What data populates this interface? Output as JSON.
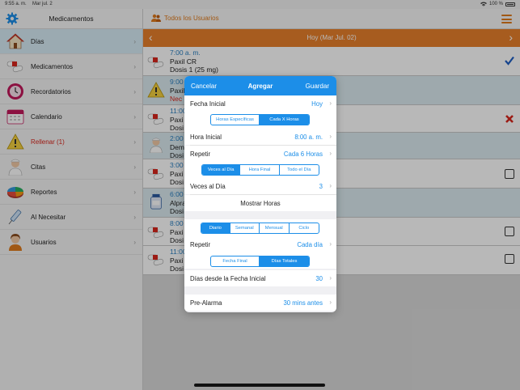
{
  "status_bar": {
    "time": "9:55 a. m.",
    "date": "Mar jul. 2",
    "battery": "100 %"
  },
  "sidebar": {
    "title": "Medicamentos",
    "items": [
      {
        "label": "Días",
        "icon": "house-icon",
        "active": true
      },
      {
        "label": "Medicamentos",
        "icon": "pills-icon"
      },
      {
        "label": "Recordatorios",
        "icon": "clock-icon"
      },
      {
        "label": "Calendario",
        "icon": "calendar-icon"
      },
      {
        "label": "Rellenar (1)",
        "icon": "warning-icon",
        "alert": true
      },
      {
        "label": "Citas",
        "icon": "nurse-icon"
      },
      {
        "label": "Reportes",
        "icon": "pie-chart-icon"
      },
      {
        "label": "Al Necesitar",
        "icon": "syringe-icon"
      },
      {
        "label": "Usuarios",
        "icon": "user-icon"
      }
    ]
  },
  "header": {
    "users_label": "Todos los Usuarios"
  },
  "date_bar": {
    "title": "Hoy (Mar Jul. 02)"
  },
  "list": {
    "rows": [
      {
        "time": "7:00 a. m.",
        "line2": "Paxil CR",
        "line3": "Dosis 1 (25 mg)",
        "status": "taken"
      },
      {
        "time": "9:00",
        "line2": "Paxil",
        "line3": "Nec",
        "status": "none"
      },
      {
        "time": "11:00",
        "line2": "Paxi",
        "line3": "Dosi",
        "status": "skipped"
      },
      {
        "time": "2:00",
        "line2": "Dem",
        "line3": "Dosi",
        "status": "none"
      },
      {
        "time": "3:00",
        "line2": "Paxi",
        "line3": "Dosi",
        "status": "pending"
      },
      {
        "time": "6:00",
        "line2": "Alpra",
        "line3": "Dosi",
        "status": "none"
      },
      {
        "time": "8:00",
        "line2": "Paxi",
        "line3": "Dosi",
        "status": "pending"
      },
      {
        "time": "11:00",
        "line2": "Paxi",
        "line3": "Dosi",
        "status": "pending"
      }
    ]
  },
  "modal": {
    "cancel": "Cancelar",
    "title": "Agregar",
    "save": "Guardar",
    "start_date_label": "Fecha Inicial",
    "start_date_value": "Hoy",
    "mode_seg": [
      "Horas Específicas",
      "Cada X Horas"
    ],
    "mode_selected": 1,
    "start_time_label": "Hora Inicial",
    "start_time_value": "8:00 a. m.",
    "repeat_label": "Repetir",
    "repeat_value": "Cada 6 Horas",
    "times_seg": [
      "Veces al Día",
      "Hora Final",
      "Todo el Día"
    ],
    "times_selected": 0,
    "times_per_day_label": "Veces al Día",
    "times_per_day_value": "3",
    "show_hours": "Mostrar Horas",
    "freq_seg": [
      "Diario",
      "Semanal",
      "Mensual",
      "Ciclo"
    ],
    "freq_selected": 0,
    "repeat2_label": "Repetir",
    "repeat2_value": "Cada día",
    "end_seg": [
      "Fecha Final",
      "Días Totales"
    ],
    "end_selected": 1,
    "days_label": "Días desde la Fecha Inicial",
    "days_value": "30",
    "prealarm_label": "Pre-Alarma",
    "prealarm_value": "30 mins antes"
  },
  "colors": {
    "accent_blue": "#1c8ee8",
    "accent_orange": "#e8802c",
    "alert_red": "#d9261c"
  }
}
